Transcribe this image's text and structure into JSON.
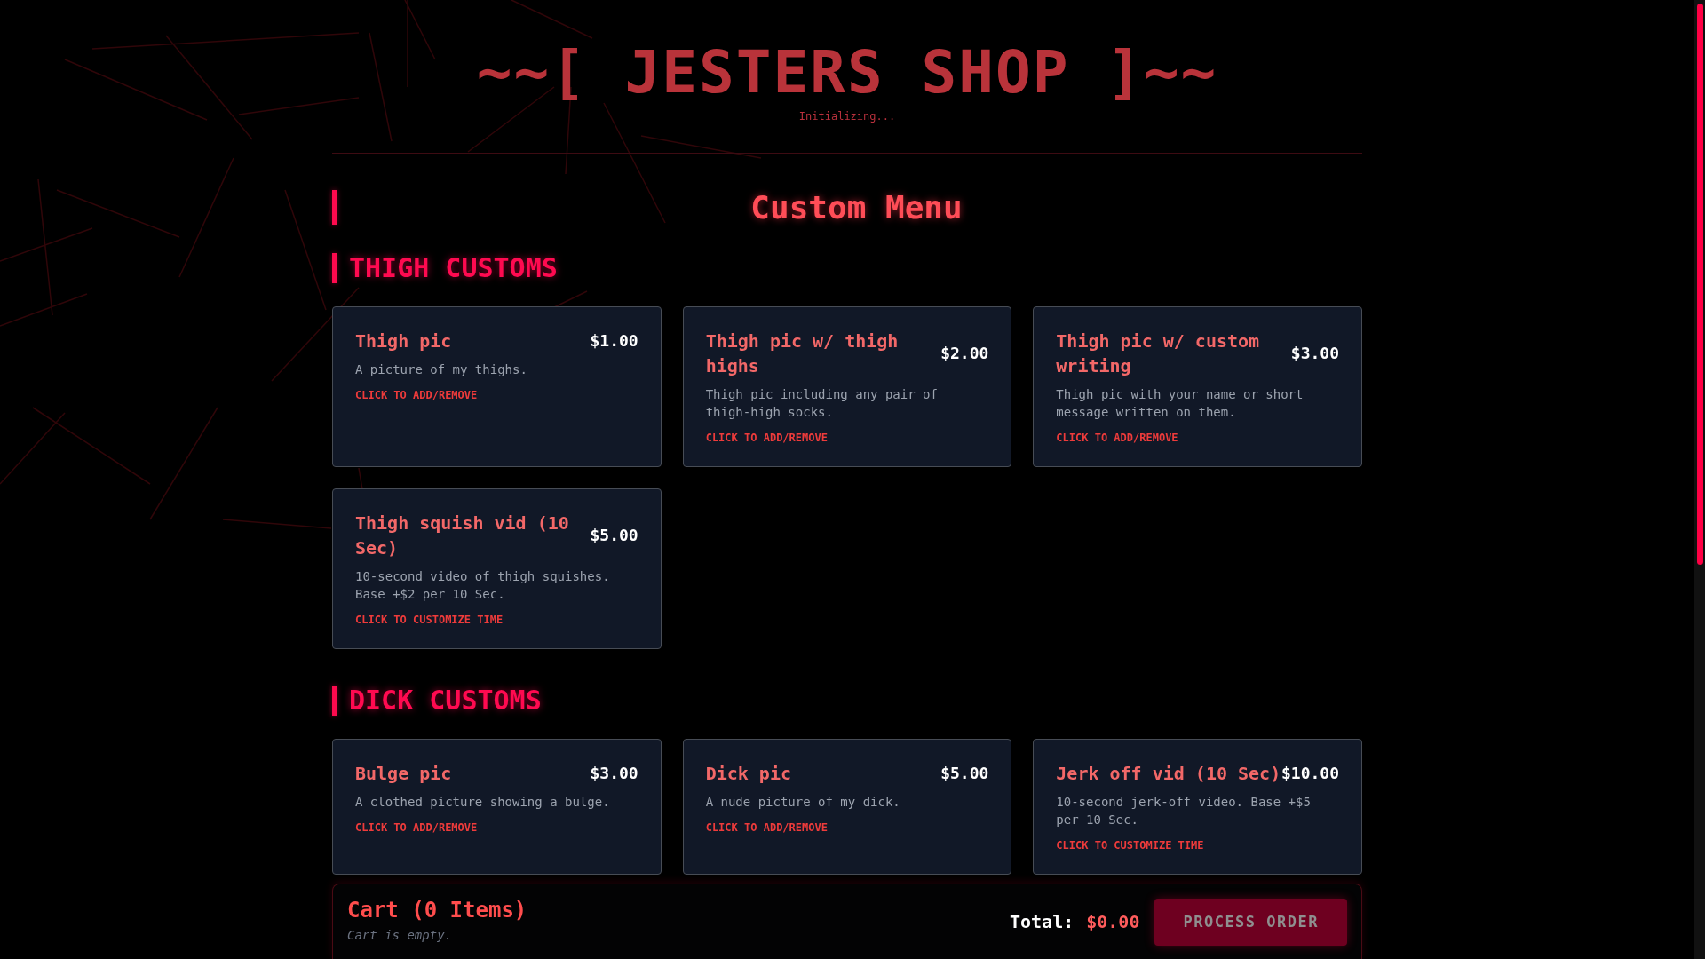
{
  "header": {
    "title": "~~[ JESTERS SHOP ]~~",
    "status": "Initializing..."
  },
  "menu": {
    "title": "Custom Menu",
    "sections": [
      {
        "title": "THIGH CUSTOMS",
        "items": [
          {
            "name": "Thigh pic",
            "price": "$1.00",
            "description": "A picture of my thighs.",
            "action": "CLICK TO ADD/REMOVE"
          },
          {
            "name": "Thigh pic w/ thigh highs",
            "price": "$2.00",
            "description": "Thigh pic including any pair of thigh-high socks.",
            "action": "CLICK TO ADD/REMOVE"
          },
          {
            "name": "Thigh pic w/ custom writing",
            "price": "$3.00",
            "description": "Thigh pic with your name or short message written on them.",
            "action": "CLICK TO ADD/REMOVE"
          },
          {
            "name": "Thigh squish vid (10 Sec)",
            "price": "$5.00",
            "description": "10-second video of thigh squishes. Base +$2 per 10 Sec.",
            "action": "CLICK TO CUSTOMIZE TIME"
          }
        ]
      },
      {
        "title": "DICK CUSTOMS",
        "items": [
          {
            "name": "Bulge pic",
            "price": "$3.00",
            "description": "A clothed picture showing a bulge.",
            "action": "CLICK TO ADD/REMOVE"
          },
          {
            "name": "Dick pic",
            "price": "$5.00",
            "description": "A nude picture of my dick.",
            "action": "CLICK TO ADD/REMOVE"
          },
          {
            "name": "Jerk off vid (10 Sec)",
            "price": "$10.00",
            "description": "10-second jerk-off video. Base +$5 per 10 Sec.",
            "action": "CLICK TO CUSTOMIZE TIME"
          }
        ]
      }
    ]
  },
  "cart": {
    "title": "Cart (0 Items)",
    "empty_message": "Cart is empty.",
    "total_label": "Total:",
    "total": "$0.00",
    "button": {
      "label": "PROCESS ORDER",
      "disabled": true
    }
  }
}
